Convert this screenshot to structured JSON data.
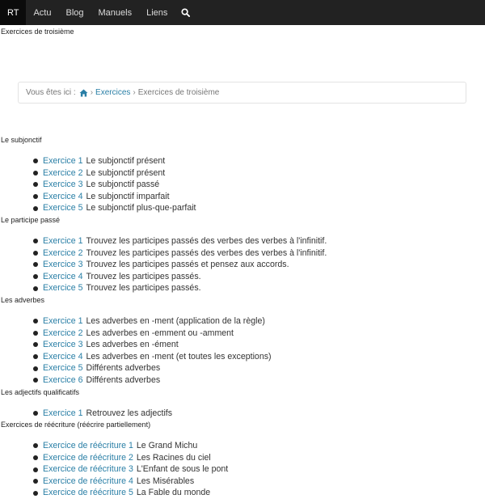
{
  "navbar": {
    "items": [
      {
        "label": "RT",
        "active": true
      },
      {
        "label": "Actu"
      },
      {
        "label": "Blog"
      },
      {
        "label": "Manuels"
      },
      {
        "label": "Liens"
      }
    ],
    "search_icon": "search-icon"
  },
  "page": {
    "title": "Exercices de troisième"
  },
  "breadcrumb": {
    "prefix": "Vous êtes ici :",
    "home_icon": "home-icon",
    "link": "Exercices",
    "current": "Exercices de troisième"
  },
  "sections": [
    {
      "title": "Le subjonctif",
      "items": [
        {
          "link": "Exercice 1",
          "text": "Le subjonctif présent"
        },
        {
          "link": "Exercice 2",
          "text": "Le subjonctif présent"
        },
        {
          "link": "Exercice 3",
          "text": "Le subjonctif passé"
        },
        {
          "link": "Exercice 4",
          "text": "Le subjonctif imparfait"
        },
        {
          "link": "Exercice 5",
          "text": "Le subjonctif plus-que-parfait"
        }
      ]
    },
    {
      "title": "Le participe passé",
      "items": [
        {
          "link": "Exercice 1",
          "text": "Trouvez les participes passés des verbes des verbes à l'infinitif."
        },
        {
          "link": "Exercice 2",
          "text": "Trouvez les participes passés des verbes des verbes à l'infinitif."
        },
        {
          "link": "Exercice 3",
          "text": "Trouvez les participes passés et pensez aux accords."
        },
        {
          "link": "Exercice 4",
          "text": "Trouvez les participes passés."
        },
        {
          "link": "Exercice 5",
          "text": "Trouvez les participes passés."
        }
      ]
    },
    {
      "title": "Les adverbes",
      "items": [
        {
          "link": "Exercice 1",
          "text": "Les adverbes en -ment (application de la règle)"
        },
        {
          "link": "Exercice 2",
          "text": "Les adverbes en -emment ou -amment"
        },
        {
          "link": "Exercice 3",
          "text": "Les adverbes en -ément"
        },
        {
          "link": "Exercice 4",
          "text": "Les adverbes en -ment (et toutes les exceptions)"
        },
        {
          "link": "Exercice 5",
          "text": "Différents adverbes"
        },
        {
          "link": "Exercice 6",
          "text": "Différents adverbes"
        }
      ]
    },
    {
      "title": "Les adjectifs qualificatifs",
      "items": [
        {
          "link": "Exercice 1",
          "text": "Retrouvez les adjectifs"
        }
      ]
    },
    {
      "title": "Exercices de réécriture (réécrire partiellement)",
      "items": [
        {
          "link": "Exercice de réécriture 1",
          "text": "Le Grand Michu"
        },
        {
          "link": "Exercice de réécriture 2",
          "text": "Les Racines du ciel"
        },
        {
          "link": "Exercice de réécriture 3",
          "text": "L'Enfant de sous le pont"
        },
        {
          "link": "Exercice de réécriture 4",
          "text": "Les Misérables"
        },
        {
          "link": "Exercice de réécriture 5",
          "text": "La Fable du monde"
        }
      ]
    }
  ]
}
